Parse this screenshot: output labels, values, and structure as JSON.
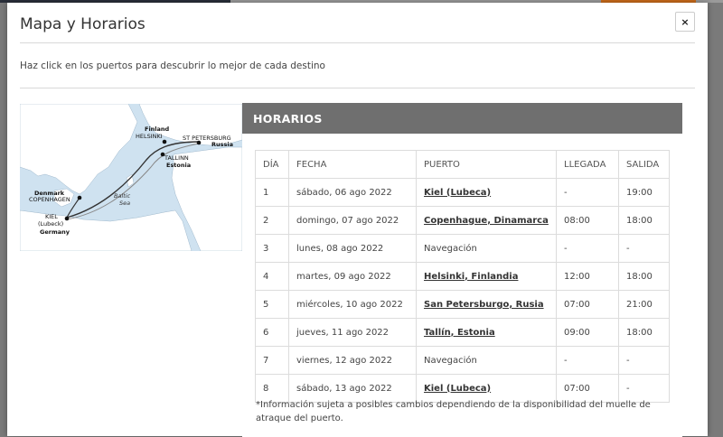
{
  "modal": {
    "title": "Mapa y Horarios",
    "close_icon": "close-icon",
    "close_label": "×",
    "subtitle": "Haz click en los puertos para descubrir lo mejor de cada destino"
  },
  "map": {
    "labels": {
      "finland": "Finland",
      "helsinki": "HELSINKI",
      "st_petersburg": "ST PETERSBURG",
      "russia": "Russia",
      "tallinn": "TALLINN",
      "estonia": "Estonia",
      "denmark": "Denmark",
      "copenhagen": "COPENHAGEN",
      "baltic_sea": "Baltic",
      "baltic_sea2": "Sea",
      "kiel": "KIEL",
      "lubeck": "(Lubeck)",
      "germany": "Germany"
    }
  },
  "schedule": {
    "header": "HORARIOS",
    "columns": [
      "DÍA",
      "FECHA",
      "PUERTO",
      "LLEGADA",
      "SALIDA"
    ],
    "rows": [
      {
        "dia": "1",
        "fecha": "sábado, 06 ago 2022",
        "puerto": "Kiel (Lubeca)",
        "link": true,
        "llegada": "-",
        "salida": "19:00"
      },
      {
        "dia": "2",
        "fecha": "domingo, 07 ago 2022",
        "puerto": "Copenhague, Dinamarca",
        "link": true,
        "llegada": "08:00",
        "salida": "18:00"
      },
      {
        "dia": "3",
        "fecha": "lunes, 08 ago 2022",
        "puerto": "Navegación",
        "link": false,
        "llegada": "-",
        "salida": "-"
      },
      {
        "dia": "4",
        "fecha": "martes, 09 ago 2022",
        "puerto": "Helsinki, Finlandia",
        "link": true,
        "llegada": "12:00",
        "salida": "18:00"
      },
      {
        "dia": "5",
        "fecha": "miércoles, 10 ago 2022",
        "puerto": "San Petersburgo, Rusia",
        "link": true,
        "llegada": "07:00",
        "salida": "21:00"
      },
      {
        "dia": "6",
        "fecha": "jueves, 11 ago 2022",
        "puerto": "Tallín, Estonia",
        "link": true,
        "llegada": "09:00",
        "salida": "18:00"
      },
      {
        "dia": "7",
        "fecha": "viernes, 12 ago 2022",
        "puerto": "Navegación",
        "link": false,
        "llegada": "-",
        "salida": "-"
      },
      {
        "dia": "8",
        "fecha": "sábado, 13 ago 2022",
        "puerto": "Kiel (Lubeca)",
        "link": true,
        "llegada": "07:00",
        "salida": "-"
      }
    ],
    "note": "*Información sujeta a posibles cambios dependiendo de la disponibilidad del muelle de atraque del puerto."
  },
  "colors": {
    "header_bg": "#6f6f6f",
    "overlay": "#7a7a7a",
    "sea": "#cfe2f0",
    "land": "#ffffff"
  }
}
